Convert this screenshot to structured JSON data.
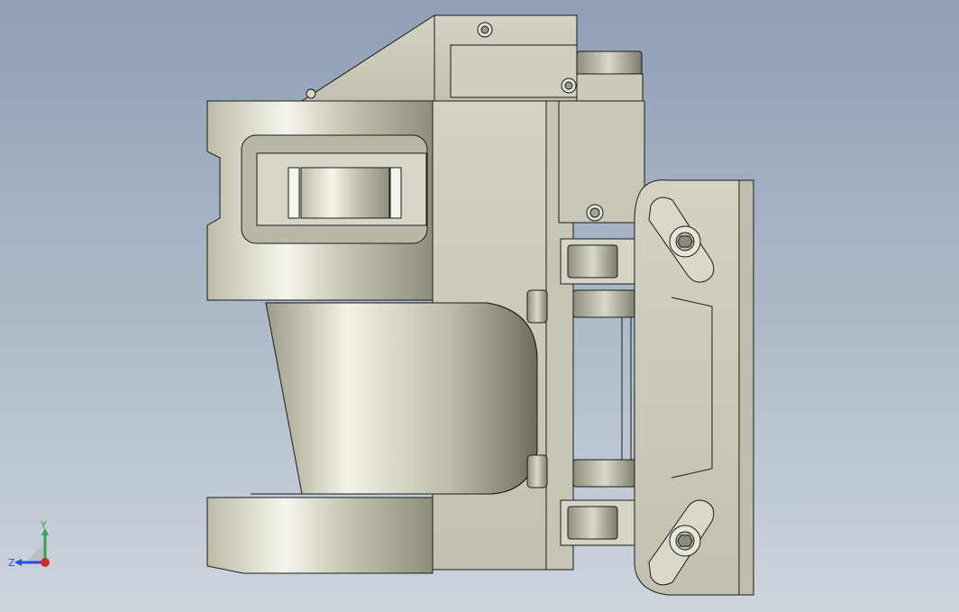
{
  "viewport": {
    "background_top": "#8fa0b6",
    "background_bottom": "#cdd5dd",
    "model_body_color": "#c9c8b8",
    "model_highlight_color": "#f4f3ea",
    "edge_color": "#1a1a1a"
  },
  "triad": {
    "y_label": "Y",
    "z_label": "Z",
    "y_axis_color": "#2fa84a",
    "z_axis_color": "#2a4fd6",
    "x_axis_color": "#d62a2a"
  }
}
